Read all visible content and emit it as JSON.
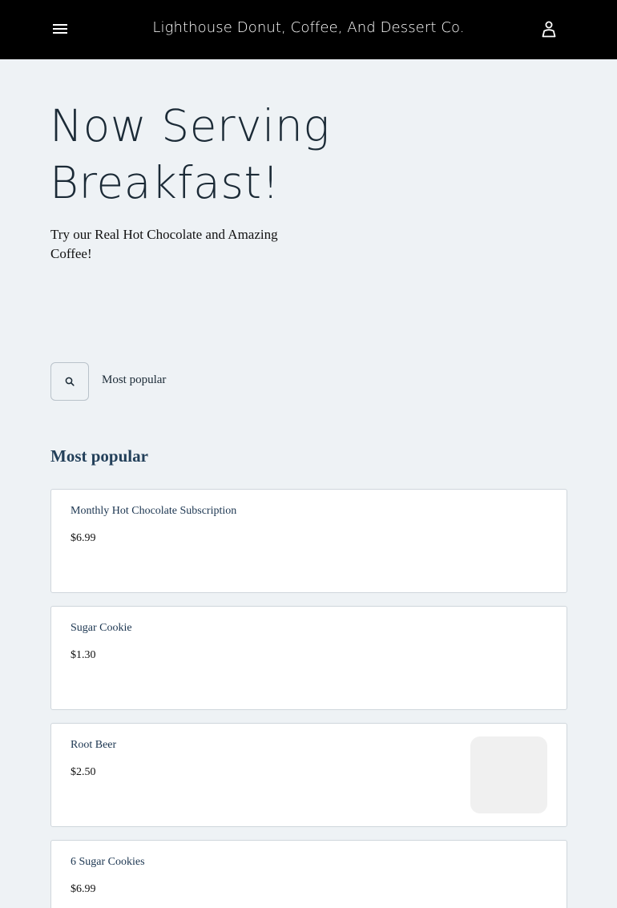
{
  "header": {
    "brand": "Lighthouse Donut, Coffee, And Dessert Co.",
    "menu_icon": "hamburger-menu-icon",
    "account_icon": "user-account-icon",
    "background": "#000000"
  },
  "hero": {
    "title": "Now Serving Breakfast!",
    "subtitle": "Try our Real Hot Chocolate and Amazing Coffee!"
  },
  "filter": {
    "search_icon": "search-icon",
    "active_category": "Most popular"
  },
  "section": {
    "heading": "Most popular"
  },
  "items": [
    {
      "name": "Monthly Hot Chocolate Subscription",
      "price": "$6.99"
    },
    {
      "name": "Sugar Cookie",
      "price": "$1.30"
    },
    {
      "name": "Root Beer",
      "price": "$2.50"
    },
    {
      "name": "6 Sugar Cookies",
      "price": "$6.99"
    }
  ],
  "colors": {
    "page_background": "#eef2f5",
    "card_background": "#ffffff",
    "heading_accent": "#23405a"
  }
}
